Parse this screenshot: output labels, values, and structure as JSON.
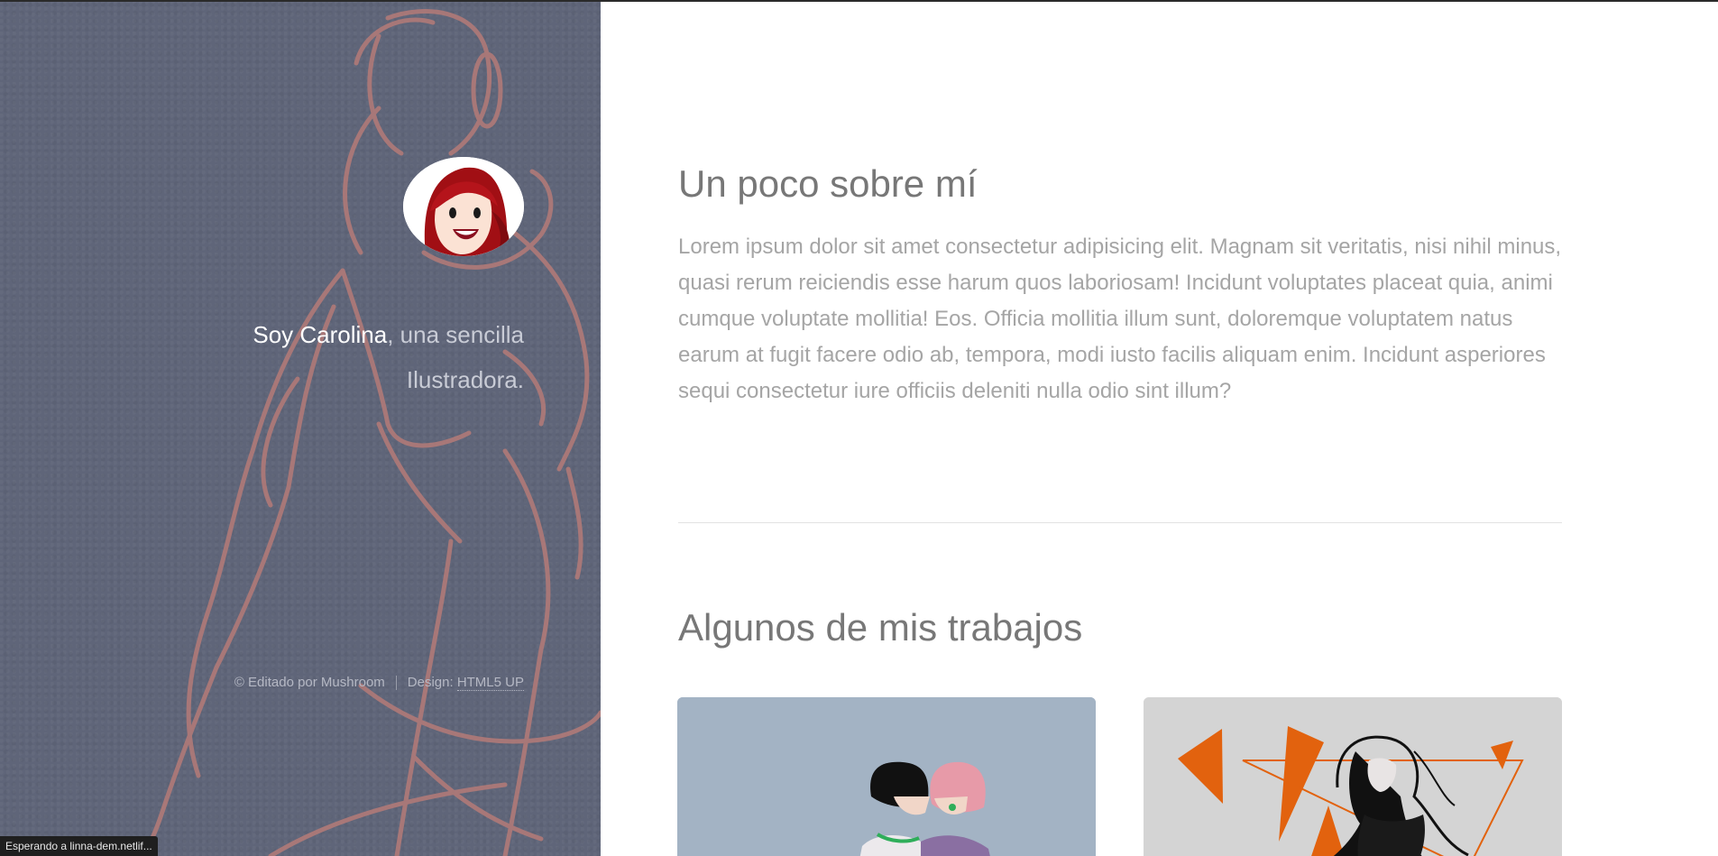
{
  "sidebar": {
    "intro_name": "Soy Carolina",
    "intro_rest": ", una sencilla Ilustradora.",
    "footer_credit": "© Editado por Mushroom",
    "footer_design_label": "Design:",
    "footer_design_link": "HTML5 UP"
  },
  "main": {
    "about_heading": "Un poco sobre mí",
    "about_text": "Lorem ipsum dolor sit amet consectetur adipisicing elit. Magnam sit veritatis, nisi nihil minus, quasi rerum reiciendis esse harum quos laboriosam! Incidunt voluptates placeat quia, animi cumque voluptate mollitia! Eos. Officia mollitia illum sunt, doloremque voluptatem natus earum at fugit facere odio ab, tempora, modi iusto facilis aliquam enim. Incidunt asperiores sequi consectetur iure officiis deleniti nulla odio sint illum?",
    "works_heading": "Algunos de mis trabajos"
  },
  "status_bar": {
    "text": "Esperando a linna-dem.netlif..."
  },
  "colors": {
    "sidebar_bg": "#5f6579",
    "sketch": "#b07a78",
    "heading": "#777777",
    "body_text": "#a5a5a5"
  }
}
